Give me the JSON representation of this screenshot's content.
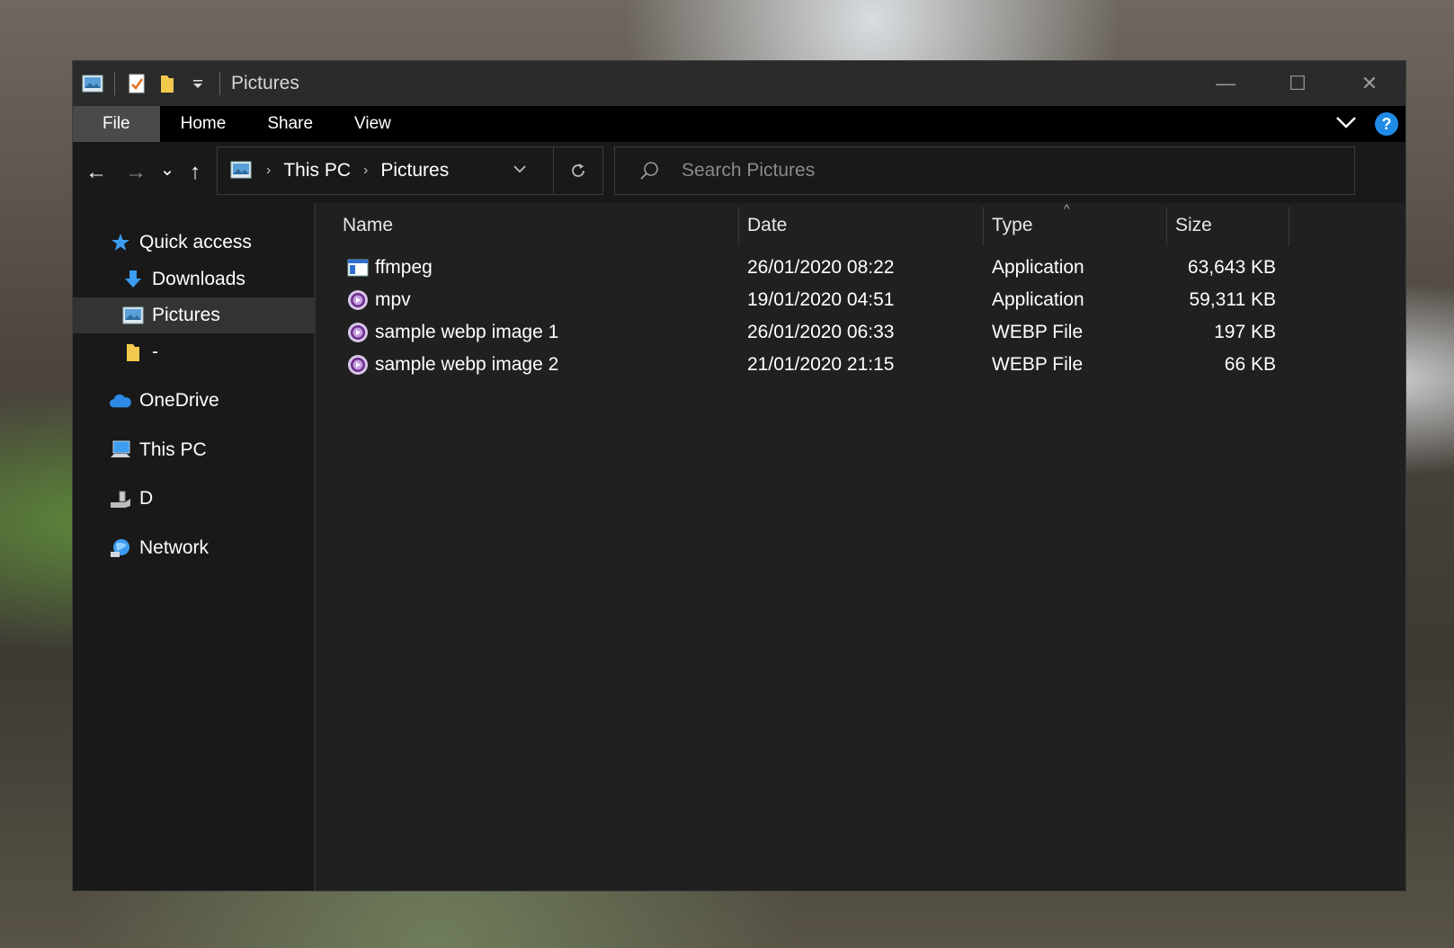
{
  "window": {
    "title": "Pictures",
    "controls": {
      "minimize": "—",
      "maximize": "☐",
      "close": "✕"
    }
  },
  "ribbon": {
    "tabs": [
      {
        "label": "File"
      },
      {
        "label": "Home"
      },
      {
        "label": "Share"
      },
      {
        "label": "View"
      }
    ],
    "help_label": "?"
  },
  "navigation": {
    "back": "←",
    "forward": "→",
    "recent": "⌄",
    "up": "↑",
    "breadcrumbs": [
      "This PC",
      "Pictures"
    ],
    "search_placeholder": "Search Pictures"
  },
  "sidebar": {
    "items": [
      {
        "label": "Quick access",
        "icon": "star-icon"
      },
      {
        "label": "Downloads",
        "icon": "download-arrow-icon",
        "pinned": true
      },
      {
        "label": "Pictures",
        "icon": "pictures-icon",
        "pinned": true,
        "selected": true
      },
      {
        "label": "-",
        "icon": "folder-icon",
        "pinned": true
      },
      {
        "label": "OneDrive",
        "icon": "cloud-icon"
      },
      {
        "label": "This PC",
        "icon": "computer-icon"
      },
      {
        "label": "D",
        "icon": "usb-drive-icon"
      },
      {
        "label": "Network",
        "icon": "network-icon"
      }
    ]
  },
  "columns": {
    "name": "Name",
    "date": "Date",
    "type": "Type",
    "size": "Size",
    "sort_indicator": "^"
  },
  "files": [
    {
      "name": "ffmpeg",
      "date": "26/01/2020 08:22",
      "type": "Application",
      "size": "63,643 KB",
      "icon": "application-window-icon"
    },
    {
      "name": "mpv",
      "date": "19/01/2020 04:51",
      "type": "Application",
      "size": "59,311 KB",
      "icon": "mpv-player-icon"
    },
    {
      "name": "sample webp image 1",
      "date": "26/01/2020 06:33",
      "type": "WEBP File",
      "size": "197 KB",
      "icon": "mpv-player-icon"
    },
    {
      "name": "sample webp image 2",
      "date": "21/01/2020 21:15",
      "type": "WEBP File",
      "size": "66 KB",
      "icon": "mpv-player-icon"
    }
  ],
  "colors": {
    "accent_help": "#1e8ae6",
    "window_bg": "#202020",
    "sidebar_bg": "#191919",
    "selected_bg": "#333333",
    "mpv_purple": "#6b2d8a"
  }
}
